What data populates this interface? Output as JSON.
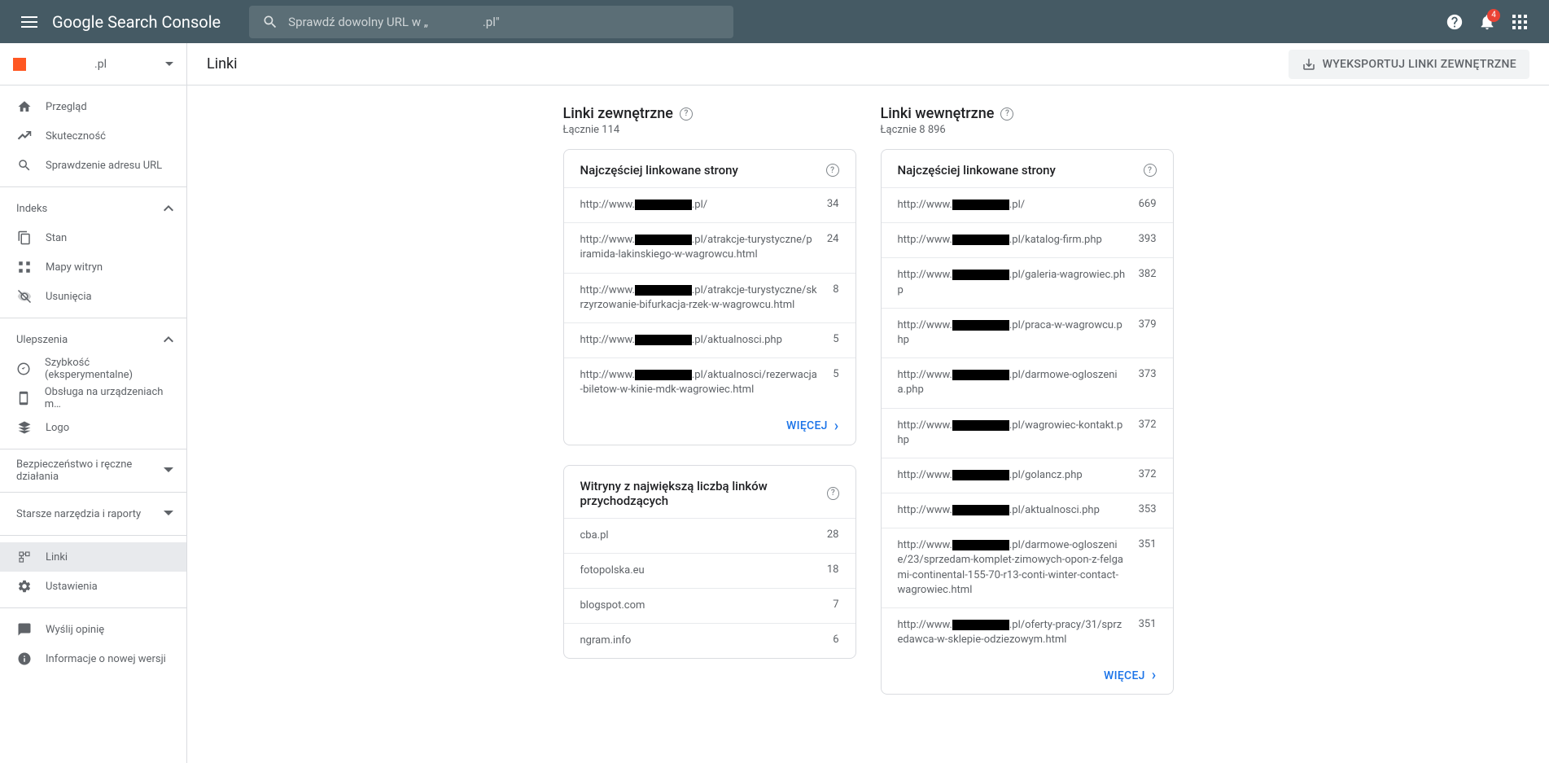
{
  "header": {
    "logo": "Google Search Console",
    "search_placeholder": "Sprawdź dowolny URL w „                  .pl\"",
    "notification_count": "4"
  },
  "sidebar": {
    "site_label": ".pl",
    "nav": {
      "overview": "Przegląd",
      "performance": "Skuteczność",
      "url_inspect": "Sprawdzenie adresu URL",
      "index_header": "Indeks",
      "coverage": "Stan",
      "sitemaps": "Mapy witryn",
      "removals": "Usunięcia",
      "enhancements_header": "Ulepszenia",
      "speed": "Szybkość (eksperymentalne)",
      "mobile": "Obsługa na urządzeniach m…",
      "logo": "Logo",
      "security_header": "Bezpieczeństwo i ręczne działania",
      "legacy_header": "Starsze narzędzia i raporty",
      "links": "Linki",
      "settings": "Ustawienia",
      "feedback": "Wyślij opinię",
      "about": "Informacje o nowej wersji"
    }
  },
  "main": {
    "title": "Linki",
    "export": "WYEKSPORTUJ LINKI ZEWNĘTRZNE",
    "external": {
      "title": "Linki zewnętrzne",
      "subtitle": "Łącznie 114",
      "card1_title": "Najczęściej linkowane strony",
      "card2_title": "Witryny z największą liczbą linków przychodzących",
      "more": "WIĘCEJ"
    },
    "internal": {
      "title": "Linki wewnętrzne",
      "subtitle": "Łącznie 8 896",
      "card1_title": "Najczęściej linkowane strony",
      "more": "WIĘCEJ"
    }
  },
  "external_top_pages": [
    {
      "prefix": "http://www.",
      "suffix": ".pl/",
      "count": "34"
    },
    {
      "prefix": "http://www.",
      "suffix": ".pl/atrakcje-turystyczne/piramida-lakinskiego-w-wagrowcu.html",
      "count": "24"
    },
    {
      "prefix": "http://www.",
      "suffix": ".pl/atrakcje-turystyczne/skrzyrzowanie-bifurkacja-rzek-w-wagrowcu.html",
      "count": "8"
    },
    {
      "prefix": "http://www.",
      "suffix": ".pl/aktualnosci.php",
      "count": "5"
    },
    {
      "prefix": "http://www.",
      "suffix": ".pl/aktualnosci/rezerwacja-biletow-w-kinie-mdk-wagrowiec.html",
      "count": "5"
    }
  ],
  "external_top_sites": [
    {
      "site": "cba.pl",
      "count": "28"
    },
    {
      "site": "fotopolska.eu",
      "count": "18"
    },
    {
      "site": "blogspot.com",
      "count": "7"
    },
    {
      "site": "ngram.info",
      "count": "6"
    }
  ],
  "internal_top_pages": [
    {
      "prefix": "http://www.",
      "suffix": ".pl/",
      "count": "669"
    },
    {
      "prefix": "http://www.",
      "suffix": ".pl/katalog-firm.php",
      "count": "393"
    },
    {
      "prefix": "http://www.",
      "suffix": ".pl/galeria-wagrowiec.php",
      "count": "382"
    },
    {
      "prefix": "http://www.",
      "suffix": ".pl/praca-w-wagrowcu.php",
      "count": "379"
    },
    {
      "prefix": "http://www.",
      "suffix": ".pl/darmowe-ogloszenia.php",
      "count": "373"
    },
    {
      "prefix": "http://www.",
      "suffix": ".pl/wagrowiec-kontakt.php",
      "count": "372"
    },
    {
      "prefix": "http://www.",
      "suffix": ".pl/golancz.php",
      "count": "372"
    },
    {
      "prefix": "http://www.",
      "suffix": ".pl/aktualnosci.php",
      "count": "353"
    },
    {
      "prefix": "http://www.",
      "suffix": ".pl/darmowe-ogloszenie/23/sprzedam-komplet-zimowych-opon-z-felgami-continental-155-70-r13-conti-winter-contact-wagrowiec.html",
      "count": "351"
    },
    {
      "prefix": "http://www.",
      "suffix": ".pl/oferty-pracy/31/sprzedawca-w-sklepie-odziezowym.html",
      "count": "351"
    }
  ]
}
